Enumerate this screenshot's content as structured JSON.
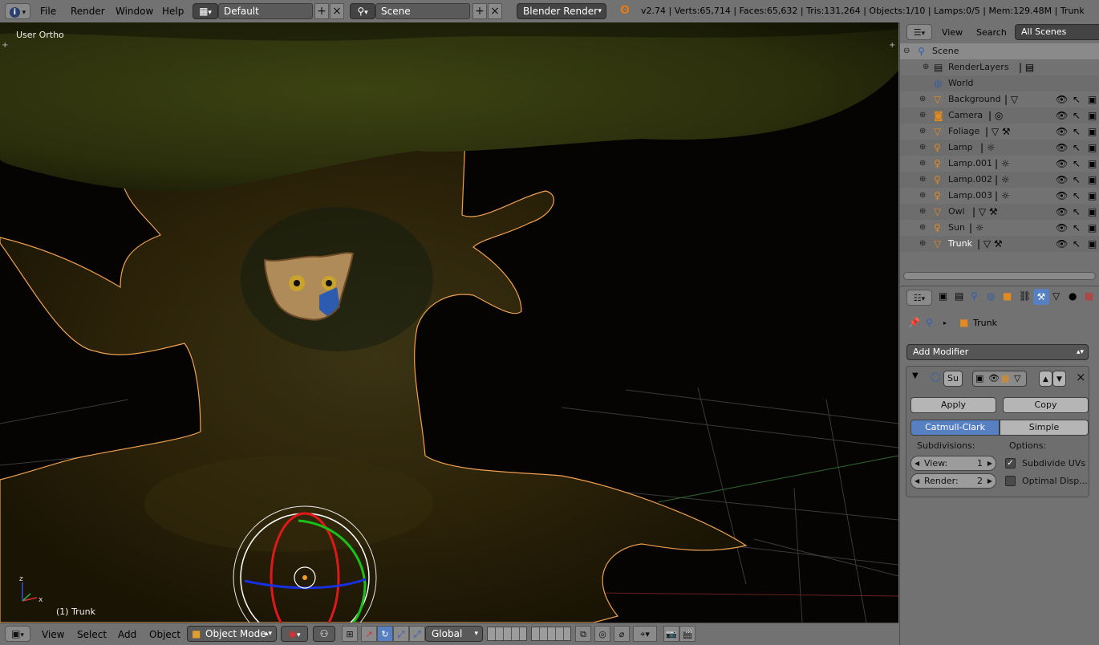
{
  "topbar": {
    "menus": [
      "File",
      "Render",
      "Window",
      "Help"
    ],
    "layout": "Default",
    "scene": "Scene",
    "engine": "Blender Render",
    "stats": "v2.74 | Verts:65,714 | Faces:65,632 | Tris:131,264 | Objects:1/10 | Lamps:0/5 | Mem:129.48M | Trunk"
  },
  "viewport": {
    "view_name": "User Ortho",
    "object_label": "(1) Trunk"
  },
  "viewport_header": {
    "menus": [
      "View",
      "Select",
      "Add",
      "Object"
    ],
    "mode": "Object Mode",
    "orientation": "Global"
  },
  "outliner": {
    "header": {
      "view": "View",
      "search": "Search",
      "filter": "All Scenes"
    },
    "rows": [
      {
        "label": "Scene",
        "icon": "scene-icon"
      },
      {
        "label": "RenderLayers",
        "icon": "renderlayers-icon"
      },
      {
        "label": "World",
        "icon": "world-icon"
      },
      {
        "label": "Background",
        "icon": "mesh-icon"
      },
      {
        "label": "Camera",
        "icon": "camera-icon"
      },
      {
        "label": "Foliage",
        "icon": "mesh-icon"
      },
      {
        "label": "Lamp",
        "icon": "lamp-icon"
      },
      {
        "label": "Lamp.001",
        "icon": "lamp-icon"
      },
      {
        "label": "Lamp.002",
        "icon": "lamp-icon"
      },
      {
        "label": "Lamp.003",
        "icon": "lamp-icon"
      },
      {
        "label": "Owl",
        "icon": "mesh-icon"
      },
      {
        "label": "Sun",
        "icon": "lamp-icon"
      },
      {
        "label": "Trunk",
        "icon": "mesh-icon"
      }
    ]
  },
  "properties": {
    "breadcrumb_object": "Trunk",
    "add_modifier": "Add Modifier",
    "modifier": {
      "name": "Su",
      "apply": "Apply",
      "copy": "Copy",
      "types": [
        "Catmull-Clark",
        "Simple"
      ],
      "selected_type": "Catmull-Clark",
      "subdivisions_label": "Subdivisions:",
      "options_label": "Options:",
      "view_label": "View:",
      "view_value": "1",
      "render_label": "Render:",
      "render_value": "2",
      "subdivide_uvs": "Subdivide UVs",
      "optimal_display": "Optimal Disp..."
    }
  },
  "colors": {
    "ui_gray": "#727272",
    "selection_blue": "#5680c2",
    "viewport_bg": "#050403",
    "active_outline": "#f0a050"
  }
}
